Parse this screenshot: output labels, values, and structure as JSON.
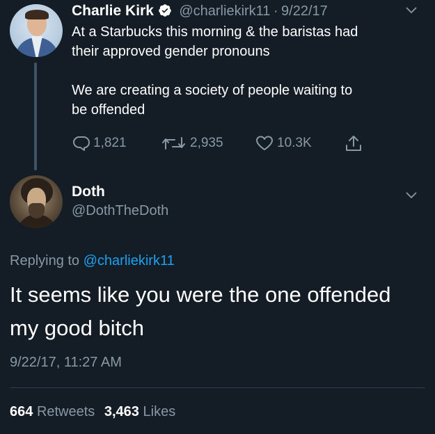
{
  "parent_tweet": {
    "author_name": "Charlie Kirk",
    "handle": "@charliekirk11",
    "separator": "·",
    "date": "9/22/17",
    "text_line1": "At a Starbucks this morning & the baristas had",
    "text_line2": "their approved gender pronouns",
    "text_line3": "We are creating a society of people waiting to",
    "text_line4": "be offended",
    "replies": "1,821",
    "retweets": "2,935",
    "likes": "10.3K"
  },
  "reply_tweet": {
    "author_name": "Doth",
    "handle": "@DothTheDoth",
    "replying_prefix": "Replying to",
    "replying_to": "@charliekirk11",
    "text_line1": "It seems like you were the one offended",
    "text_line2": "my good bitch",
    "timestamp": "9/22/17, 11:27 AM",
    "retweet_count": "664",
    "retweet_label": "Retweets",
    "like_count": "3,463",
    "like_label": "Likes"
  },
  "colors": {
    "background": "#141d26",
    "text": "#ffffff",
    "secondary": "#8899a6",
    "link": "#1da1f2",
    "verified": "#ffffff"
  },
  "icons": [
    "reply-icon",
    "retweet-icon",
    "like-icon",
    "share-icon",
    "verified-badge-icon",
    "chevron-down-icon"
  ]
}
